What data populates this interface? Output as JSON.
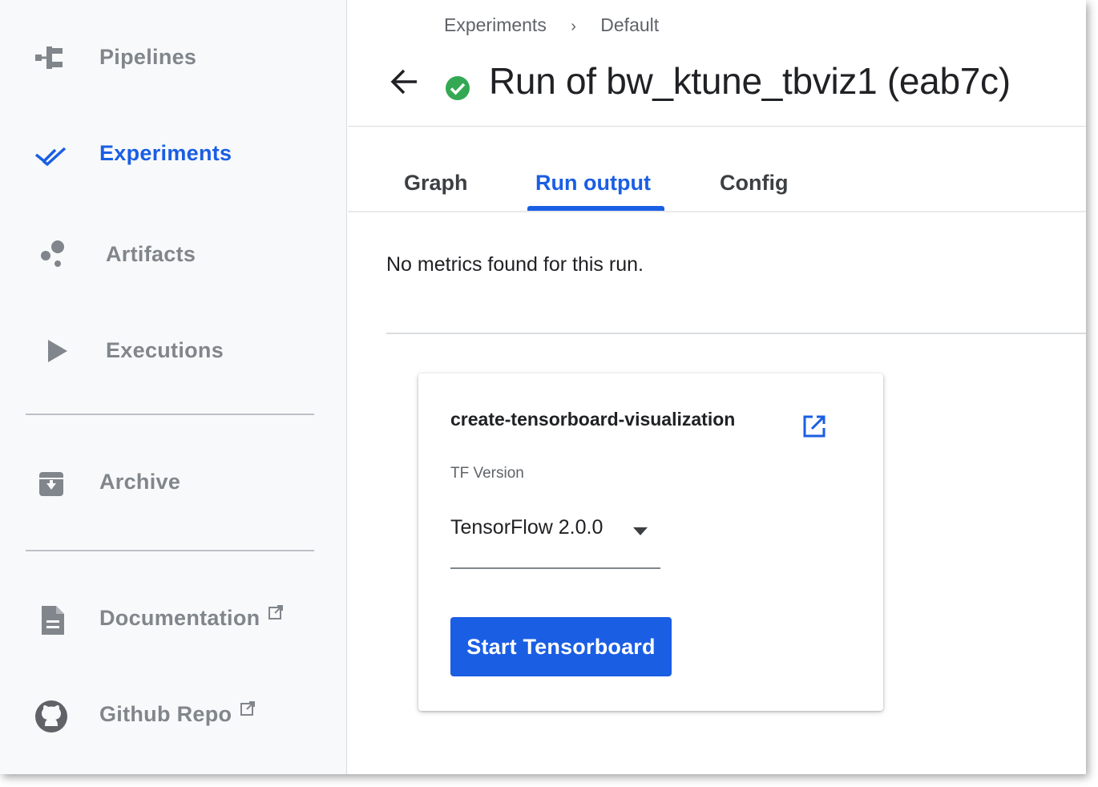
{
  "sidebar": {
    "items": [
      {
        "label": "Pipelines",
        "icon": "pipelines-icon",
        "active": false
      },
      {
        "label": "Experiments",
        "icon": "experiments-icon",
        "active": true
      },
      {
        "label": "Artifacts",
        "icon": "artifacts-icon",
        "active": false
      },
      {
        "label": "Executions",
        "icon": "executions-icon",
        "active": false
      },
      {
        "label": "Archive",
        "icon": "archive-icon",
        "active": false
      },
      {
        "label": "Documentation",
        "icon": "document-icon",
        "external": true
      },
      {
        "label": "Github Repo",
        "icon": "github-icon",
        "external": true
      }
    ]
  },
  "header": {
    "breadcrumb": [
      "Experiments",
      "Default"
    ],
    "breadcrumb_separator": "›",
    "title": "Run of bw_ktune_tbviz1 (eab7c)",
    "status": "succeeded"
  },
  "tabs": [
    {
      "label": "Graph",
      "active": false
    },
    {
      "label": "Run output",
      "active": true
    },
    {
      "label": "Config",
      "active": false
    }
  ],
  "content": {
    "no_metrics_text": "No metrics found for this run."
  },
  "card": {
    "title": "create-tensorboard-visualization",
    "version_label": "TF Version",
    "version_value": "TensorFlow 2.0.0",
    "start_button_label": "Start Tensorboard"
  },
  "colors": {
    "accent": "#1a5ee3",
    "nav_inactive": "#80868b",
    "success": "#34a853",
    "sidebar_bg": "#f8f9fa"
  }
}
